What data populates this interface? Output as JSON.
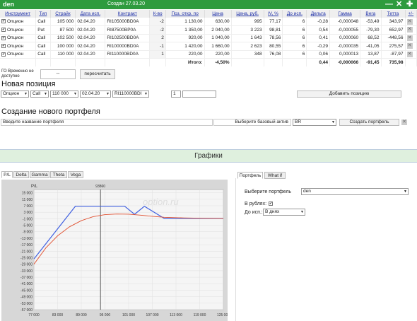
{
  "titlebar": {
    "title": "den",
    "created": "Создан 27.03.20",
    "minimize": "—",
    "close": "✕",
    "add": "✚"
  },
  "colors": {
    "accent": "#2e9b3e",
    "payoff_now": "#e05030",
    "payoff_expiry": "#4060e0"
  },
  "table": {
    "headers": [
      "Инструмент",
      "Тип",
      "Страйк",
      "Дата исп.",
      "Контракт",
      "К-во",
      "Поз. откр. по",
      "Цена",
      "Цена, руб.",
      "IV, %",
      "До исп.",
      "Дельта",
      "Гамма",
      "Вега",
      "Тетта",
      "+/-"
    ],
    "rows": [
      [
        "Опцион",
        "Call",
        "105 000",
        "02.04.20",
        "RI105000BD0A",
        "-2",
        "1 130,00",
        "630,00",
        "995",
        "77,17",
        "6",
        "-0,28",
        "-0,000048",
        "-53,49",
        "343,97"
      ],
      [
        "Опцион",
        "Put",
        "87 500",
        "02.04.20",
        "RI87500BP0A",
        "-2",
        "1 350,00",
        "2 040,00",
        "3 223",
        "98,81",
        "6",
        "0,54",
        "-0,000055",
        "-79,30",
        "652,97"
      ],
      [
        "Опцион",
        "Call",
        "102 500",
        "02.04.20",
        "RI102500BD0A",
        "2",
        "920,00",
        "1 040,00",
        "1 643",
        "78,56",
        "6",
        "0,41",
        "0,000060",
        "68,52",
        "-448,56"
      ],
      [
        "Опцион",
        "Call",
        "100 000",
        "02.04.20",
        "RI100000BD0A",
        "-1",
        "1 420,00",
        "1 660,00",
        "2 623",
        "80,55",
        "6",
        "-0,29",
        "-0,000035",
        "-41,05",
        "275,57"
      ],
      [
        "Опцион",
        "Call",
        "110 000",
        "02.04.20",
        "RI110000BD0A",
        "1",
        "220,00",
        "220,00",
        "348",
        "76,08",
        "6",
        "0,06",
        "0,000013",
        "13,87",
        "-87,97"
      ]
    ],
    "total_label": "Итого:",
    "total_pct": "-4,50%",
    "total_delta": "0,44",
    "total_gamma": "-0,000066",
    "total_vega": "-91,45",
    "total_theta": "735,98"
  },
  "go": {
    "label": "ГО Временно не доступно",
    "value": "--",
    "recalc": "пересчитать"
  },
  "new_position": {
    "title": "Новая позиция",
    "instrument": "Опцион",
    "type": "Call",
    "strike": "110 000",
    "date": "02.04.20",
    "contract": "RI110000BDI",
    "qty": "1",
    "price": "",
    "add_button": "Добавить позицию"
  },
  "new_portfolio": {
    "title": "Создание нового портфеля",
    "name_placeholder": "Введите название портфеля",
    "base_label": "Выберите базовый актив",
    "base_value": "BR",
    "create_button": "Создать портфель"
  },
  "charts_band": "Графики",
  "chart_tabs": [
    "P/L",
    "Delta",
    "Gamma",
    "Theta",
    "Vega"
  ],
  "right_tabs": [
    "Портфель",
    "What if"
  ],
  "right_panel": {
    "portfolio_label": "Выберите портфель",
    "portfolio_value": "den",
    "rub_label": "В рублях:",
    "rub_checked": "✔",
    "exp_label": "До исп.:",
    "exp_value": "В днях"
  },
  "watermark": "option.ru",
  "chart_data": {
    "type": "line",
    "ylabel": "P/L",
    "xlim": [
      77000,
      125000
    ],
    "ylim": [
      -57000,
      17000
    ],
    "current_price_label": "93860",
    "current_price": 93860,
    "x_ticks": [
      "77 000",
      "83 000",
      "89 000",
      "95 000",
      "101 000",
      "107 000",
      "113 000",
      "119 000",
      "125 000"
    ],
    "x_tick_values": [
      77000,
      83000,
      89000,
      95000,
      101000,
      107000,
      113000,
      119000,
      125000
    ],
    "y_ticks": [
      "15 000",
      "11 000",
      "7 000",
      "3 000",
      "-1 000",
      "-5 000",
      "-9 000",
      "-13 000",
      "-17 000",
      "-21 000",
      "-25 000",
      "-29 000",
      "-33 000",
      "-37 000",
      "-41 000",
      "-45 000",
      "-49 000",
      "-53 000",
      "-57 000"
    ],
    "y_tick_values": [
      15000,
      11000,
      7000,
      3000,
      -1000,
      -5000,
      -9000,
      -13000,
      -17000,
      -21000,
      -25000,
      -29000,
      -33000,
      -37000,
      -41000,
      -45000,
      -49000,
      -53000,
      -57000
    ],
    "series": [
      {
        "x": [
          77000,
          87500,
          100000,
          102500,
          103750,
          105000,
          110000,
          125000
        ],
        "y": [
          -25800,
          6700,
          6700,
          1700,
          4200,
          6700,
          -800,
          -800
        ]
      },
      {
        "x": [
          77000,
          80000,
          83000,
          86000,
          89000,
          92000,
          95000,
          98000,
          101000,
          104000,
          107000,
          110000,
          115000,
          120000,
          125000
        ],
        "y": [
          -29000,
          -19000,
          -11500,
          -6000,
          -2200,
          300,
          1500,
          1900,
          1800,
          1200,
          500,
          -100,
          -500,
          -700,
          -800
        ]
      }
    ]
  }
}
